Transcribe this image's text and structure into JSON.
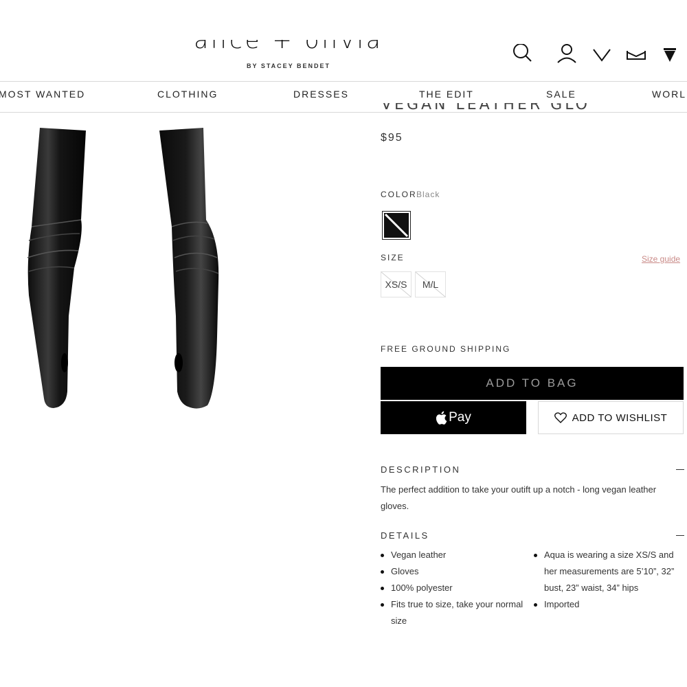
{
  "header": {
    "logo_text": "alice + olivia",
    "byline": "BY STACEY BENDET",
    "icons": [
      "search-icon",
      "account-icon",
      "heart-icon",
      "mail-icon",
      "bag-icon"
    ]
  },
  "nav": {
    "items": [
      "MOST WANTED",
      "CLOTHING",
      "DRESSES",
      "THE EDIT",
      "SALE",
      "WORLD"
    ]
  },
  "product": {
    "title": "VEGAN LEATHER GLOVES",
    "price": "$95",
    "color_label": "COLOR",
    "color_value": "Black",
    "swatch_color": "#111111",
    "size_label": "SIZE",
    "size_guide": "Size guide",
    "sizes": [
      "XS/S",
      "M/L"
    ],
    "shipping": "FREE GROUND SHIPPING",
    "add_to_bag": "ADD TO BAG",
    "apple_pay": "Pay",
    "wishlist": "ADD TO WISHLIST"
  },
  "description": {
    "heading": "DESCRIPTION",
    "text": "The perfect addition to take your outift up a notch - long vegan leather gloves."
  },
  "details": {
    "heading": "DETAILS",
    "left": [
      "Vegan leather",
      "Gloves",
      "100% polyester",
      "Fits true to size, take your normal size"
    ],
    "right": [
      "Aqua is wearing a size XS/S and her measurements are 5’10”, 32” bust, 23” waist, 34” hips",
      "Imported"
    ]
  },
  "colors": {
    "accent_link": "#c98a87",
    "button_dark": "#000000",
    "button_text_muted": "#9b9b9b"
  }
}
